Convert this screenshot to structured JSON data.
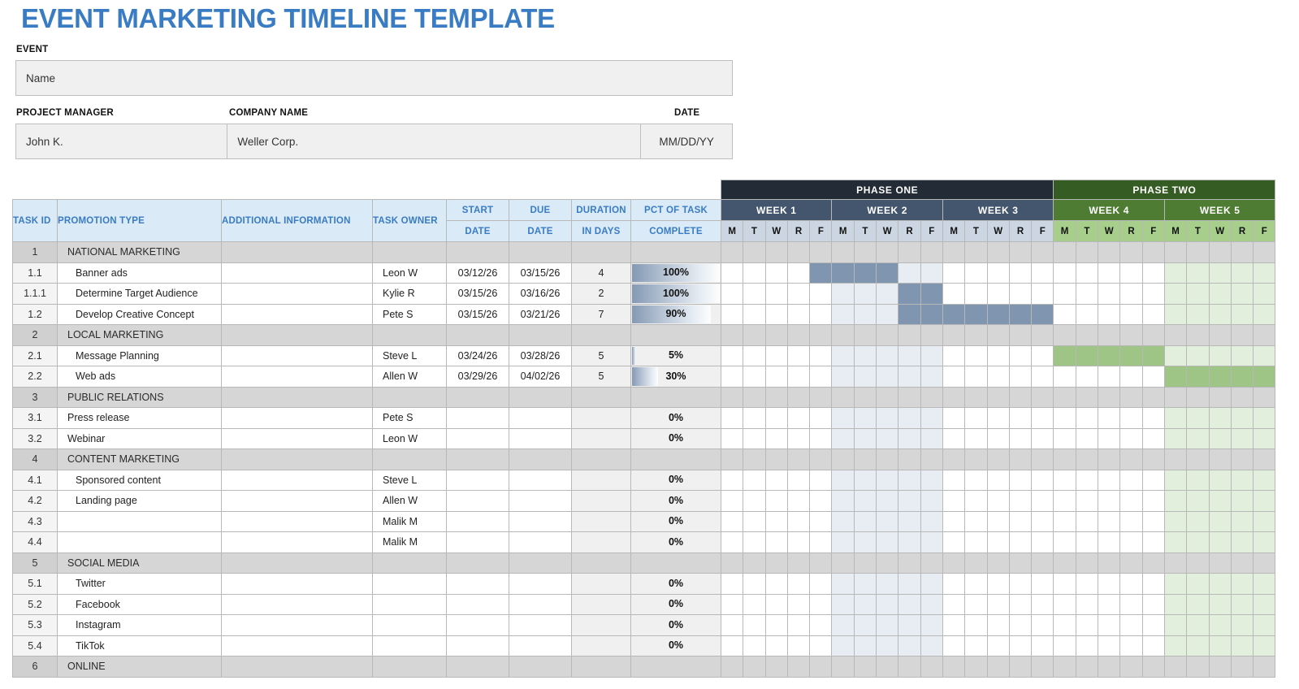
{
  "title": "EVENT MARKETING TIMELINE TEMPLATE",
  "accent_color": "#3a7cc4",
  "info": {
    "event_label": "EVENT",
    "event_value": "Name",
    "project_manager_label": "PROJECT MANAGER",
    "project_manager_value": "John K.",
    "company_name_label": "COMPANY NAME",
    "company_name_value": "Weller Corp.",
    "date_label": "DATE",
    "date_value": "MM/DD/YY"
  },
  "columns": {
    "task_id": "TASK ID",
    "promotion_type": "PROMOTION TYPE",
    "additional_information": "ADDITIONAL INFORMATION",
    "task_owner": "TASK OWNER",
    "start_top": "START",
    "start_bottom": "DATE",
    "due_top": "DUE",
    "due_bottom": "DATE",
    "duration_top": "DURATION",
    "duration_bottom": "IN DAYS",
    "pct_top": "PCT OF TASK",
    "pct_bottom": "COMPLETE"
  },
  "timeline": {
    "phases": [
      {
        "label": "PHASE ONE",
        "weeks": 3,
        "color": "#232b36"
      },
      {
        "label": "PHASE TWO",
        "weeks": 2,
        "color": "#355c22"
      }
    ],
    "weeks": [
      {
        "label": "WEEK 1",
        "phase": 1
      },
      {
        "label": "WEEK 2",
        "phase": 1
      },
      {
        "label": "WEEK 3",
        "phase": 1
      },
      {
        "label": "WEEK 4",
        "phase": 2
      },
      {
        "label": "WEEK 5",
        "phase": 2
      }
    ],
    "days": [
      "M",
      "T",
      "W",
      "R",
      "F"
    ],
    "tinted_week_indexes_blue": [
      2
    ],
    "tinted_week_indexes_green": [
      5
    ],
    "bar_color_blue": "#7f95b0",
    "bar_color_green": "#9fc586"
  },
  "rows": [
    {
      "type": "group",
      "id": "1",
      "name": "NATIONAL MARKETING",
      "info": "",
      "owner": "",
      "start": "",
      "due": "",
      "days": "",
      "pct": "",
      "bar": null
    },
    {
      "type": "task",
      "id": "1.1",
      "name": "Banner ads",
      "info": "",
      "owner": "Leon W",
      "start": "03/12/26",
      "due": "03/15/26",
      "days": "4",
      "pct": "100%",
      "bar": {
        "start": 5,
        "span": 4,
        "color": "blue"
      }
    },
    {
      "type": "task",
      "id": "1.1.1",
      "name": "Determine Target Audience",
      "info": "",
      "owner": "Kylie R",
      "start": "03/15/26",
      "due": "03/16/26",
      "days": "2",
      "pct": "100%",
      "bar": {
        "start": 9,
        "span": 2,
        "color": "blue"
      }
    },
    {
      "type": "task",
      "id": "1.2",
      "name": "Develop Creative Concept",
      "info": "",
      "owner": "Pete S",
      "start": "03/15/26",
      "due": "03/21/26",
      "days": "7",
      "pct": "90%",
      "bar": {
        "start": 9,
        "span": 7,
        "color": "blue"
      }
    },
    {
      "type": "group",
      "id": "2",
      "name": "LOCAL MARKETING",
      "info": "",
      "owner": "",
      "start": "",
      "due": "",
      "days": "",
      "pct": "",
      "bar": null
    },
    {
      "type": "task",
      "id": "2.1",
      "name": "Message Planning",
      "info": "",
      "owner": "Steve L",
      "start": "03/24/26",
      "due": "03/28/26",
      "days": "5",
      "pct": "5%",
      "bar": {
        "start": 16,
        "span": 5,
        "color": "green"
      }
    },
    {
      "type": "task",
      "id": "2.2",
      "name": "Web ads",
      "info": "",
      "owner": "Allen W",
      "start": "03/29/26",
      "due": "04/02/26",
      "days": "5",
      "pct": "30%",
      "bar": {
        "start": 21,
        "span": 5,
        "color": "green"
      }
    },
    {
      "type": "group",
      "id": "3",
      "name": "PUBLIC RELATIONS",
      "info": "",
      "owner": "",
      "start": "",
      "due": "",
      "days": "",
      "pct": "",
      "bar": null
    },
    {
      "type": "task",
      "id": "3.1",
      "name": "Press release",
      "info": "",
      "owner": "Pete S",
      "start": "",
      "due": "",
      "days": "",
      "pct": "0%",
      "bar": null,
      "flush": true
    },
    {
      "type": "task",
      "id": "3.2",
      "name": "Webinar",
      "info": "",
      "owner": "Leon W",
      "start": "",
      "due": "",
      "days": "",
      "pct": "0%",
      "bar": null,
      "flush": true
    },
    {
      "type": "group",
      "id": "4",
      "name": "CONTENT MARKETING",
      "info": "",
      "owner": "",
      "start": "",
      "due": "",
      "days": "",
      "pct": "",
      "bar": null
    },
    {
      "type": "task",
      "id": "4.1",
      "name": "Sponsored content",
      "info": "",
      "owner": "Steve L",
      "start": "",
      "due": "",
      "days": "",
      "pct": "0%",
      "bar": null
    },
    {
      "type": "task",
      "id": "4.2",
      "name": "Landing page",
      "info": "",
      "owner": "Allen W",
      "start": "",
      "due": "",
      "days": "",
      "pct": "0%",
      "bar": null
    },
    {
      "type": "task",
      "id": "4.3",
      "name": "",
      "info": "",
      "owner": "Malik M",
      "start": "",
      "due": "",
      "days": "",
      "pct": "0%",
      "bar": null
    },
    {
      "type": "task",
      "id": "4.4",
      "name": "",
      "info": "",
      "owner": "Malik M",
      "start": "",
      "due": "",
      "days": "",
      "pct": "0%",
      "bar": null
    },
    {
      "type": "group",
      "id": "5",
      "name": "SOCIAL MEDIA",
      "info": "",
      "owner": "",
      "start": "",
      "due": "",
      "days": "",
      "pct": "",
      "bar": null
    },
    {
      "type": "task",
      "id": "5.1",
      "name": "Twitter",
      "info": "",
      "owner": "",
      "start": "",
      "due": "",
      "days": "",
      "pct": "0%",
      "bar": null
    },
    {
      "type": "task",
      "id": "5.2",
      "name": "Facebook",
      "info": "",
      "owner": "",
      "start": "",
      "due": "",
      "days": "",
      "pct": "0%",
      "bar": null
    },
    {
      "type": "task",
      "id": "5.3",
      "name": "Instagram",
      "info": "",
      "owner": "",
      "start": "",
      "due": "",
      "days": "",
      "pct": "0%",
      "bar": null
    },
    {
      "type": "task",
      "id": "5.4",
      "name": "TikTok",
      "info": "",
      "owner": "",
      "start": "",
      "due": "",
      "days": "",
      "pct": "0%",
      "bar": null
    },
    {
      "type": "group",
      "id": "6",
      "name": "ONLINE",
      "info": "",
      "owner": "",
      "start": "",
      "due": "",
      "days": "",
      "pct": "",
      "bar": null
    }
  ]
}
